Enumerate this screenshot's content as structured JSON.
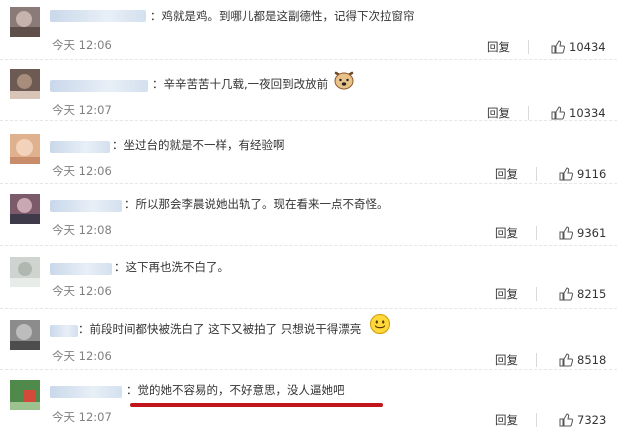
{
  "comments": [
    {
      "text": "：鸡就是鸡。到哪儿都是这副德性，记得下次拉窗帘",
      "time": "今天 12:06",
      "reply": "回复",
      "likes": "10434",
      "avatar_colors": [
        "#8a7a78",
        "#c7b3ad",
        "#5e4f4a"
      ]
    },
    {
      "text": "：辛辛苦苦十几载,一夜回到改放前",
      "time": "今天 12:07",
      "reply": "回复",
      "likes": "10334",
      "avatar_colors": [
        "#6d5a52",
        "#a88c7c",
        "#d8c5b8"
      ]
    },
    {
      "text": "：坐过台的就是不一样，有经验啊",
      "time": "今天 12:06",
      "reply": "回复",
      "likes": "9116",
      "avatar_colors": [
        "#e0b18f",
        "#f2d2bb",
        "#c88c6a"
      ]
    },
    {
      "text": "：所以那会李晨说她出轨了。现在看来一点不奇怪。",
      "time": "今天 12:08",
      "reply": "回复",
      "likes": "9361",
      "avatar_colors": [
        "#7b5a6a",
        "#c9a8b4",
        "#3f3a4a"
      ]
    },
    {
      "text": "：这下再也洗不白了。",
      "time": "今天 12:06",
      "reply": "回复",
      "likes": "8215",
      "avatar_colors": [
        "#cfd4d0",
        "#aeb7b0",
        "#e8ece9"
      ]
    },
    {
      "text": "：前段时间都快被洗白了 这下又被拍了 只想说干得漂亮",
      "time": "今天 12:06",
      "reply": "回复",
      "likes": "8518",
      "avatar_colors": [
        "#8c8c8c",
        "#bdbdbd",
        "#4d4d4d"
      ]
    },
    {
      "text": "：觉的她不容易的，不好意思，没人逼她吧",
      "time": "今天 12:07",
      "reply": "回复",
      "likes": "7323",
      "avatar_colors": [
        "#4f8a4a",
        "#d34a3a",
        "#9cc28f"
      ]
    }
  ],
  "icons": {
    "like": "thumbs-up-icon",
    "dog_emoji": "dog-emoji-icon",
    "smile_emoji": "smile-emoji-icon"
  },
  "colors": {
    "underline": "#c0161b",
    "time": "#808080",
    "username_blur": "#c9d8ea"
  }
}
